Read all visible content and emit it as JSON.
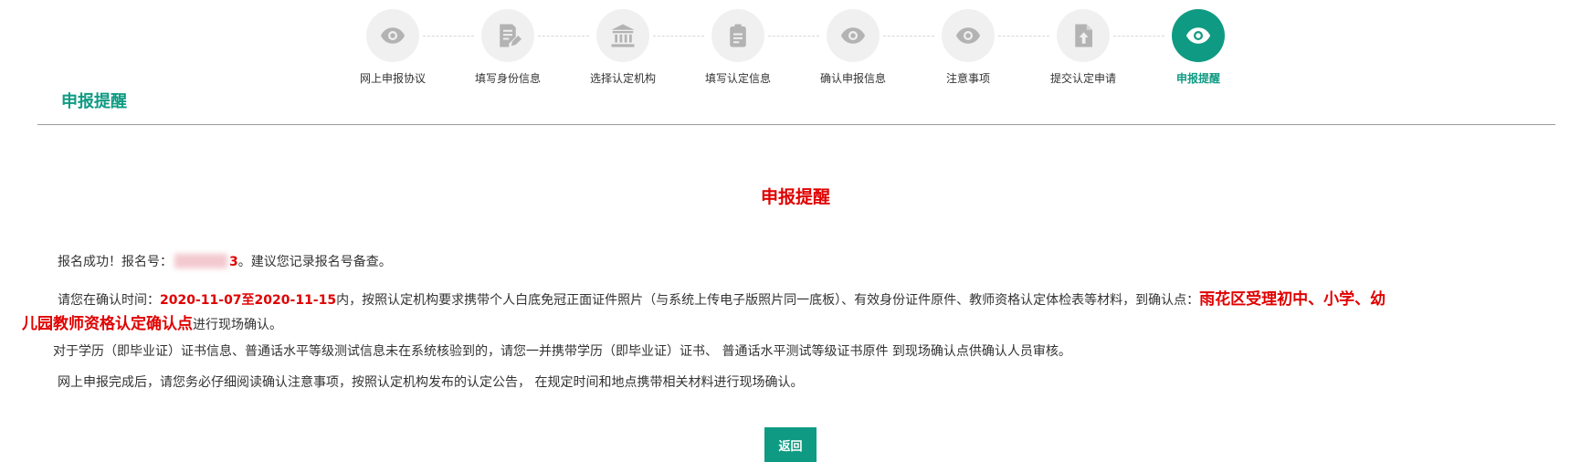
{
  "steps": [
    {
      "label": "网上申报协议",
      "icon": "eye-icon",
      "active": false
    },
    {
      "label": "填写身份信息",
      "icon": "edit-document-icon",
      "active": false
    },
    {
      "label": "选择认定机构",
      "icon": "institution-icon",
      "active": false
    },
    {
      "label": "填写认定信息",
      "icon": "clipboard-icon",
      "active": false
    },
    {
      "label": "确认申报信息",
      "icon": "eye-icon",
      "active": false
    },
    {
      "label": "注意事项",
      "icon": "eye-icon",
      "active": false
    },
    {
      "label": "提交认定申请",
      "icon": "file-upload-icon",
      "active": false
    },
    {
      "label": "申报提醒",
      "icon": "eye-icon",
      "active": true
    }
  ],
  "colors": {
    "accent": "#0f9b83",
    "alert": "#e00000",
    "inactive_step": "#f0f0f0",
    "inactive_icon": "#b3b3b3"
  },
  "page_heading": "申报提醒",
  "content": {
    "title": "申报提醒",
    "p1_prefix": "报名成功！报名号：",
    "reg_number_tail": "3",
    "p1_suffix": "。建议您记录报名号备查。",
    "p2_prefix": "请您在确认时间：",
    "date_range": "2020-11-07至2020-11-15",
    "p2_mid": "内，按照认定机构要求携带个人白底免冠正面证件照片（与系统上传电子版照片同一底板）、有效身份证件原件、教师资格认定体检表等材料，到确认点：",
    "location_part1": "雨花区受理初中、小学、幼",
    "location_part2": "儿园教师资格认定确认点",
    "p2_suffix": "进行现场确认。",
    "p3": "对于学历（即毕业证）证书信息、普通话水平等级测试信息未在系统核验到的，请您一并携带学历（即毕业证）证书、 普通话水平测试等级证书原件 到现场确认点供确认人员审核。",
    "p4": "网上申报完成后，请您务必仔细阅读确认注意事项，按照认定机构发布的认定公告， 在规定时间和地点携带相关材料进行现场确认。"
  },
  "buttons": {
    "back_label": "返回"
  }
}
